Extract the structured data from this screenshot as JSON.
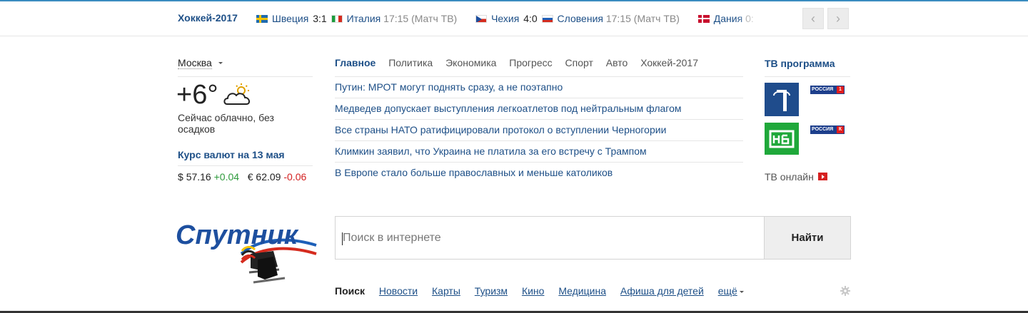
{
  "scorebar": {
    "title": "Хоккей-2017",
    "matches": [
      {
        "flag1": "se",
        "team1": "Швеция",
        "score": "3:1",
        "flag2": "it",
        "team2": "Италия",
        "time": "17:15 (Матч ТВ)"
      },
      {
        "flag1": "cz",
        "team1": "Чехия",
        "score": "4:0",
        "flag2": "si",
        "team2": "Словения",
        "time": "17:15 (Матч ТВ)"
      },
      {
        "flag1": "dk",
        "team1": "Дания",
        "score": "0:",
        "flag2": "",
        "team2": "",
        "time": ""
      }
    ],
    "prev_label": "‹",
    "next_label": "›"
  },
  "weather": {
    "city": "Москва",
    "temp": "+6°",
    "description": "Сейчас облачно, без осадков",
    "icon": "cloudy-sun-icon"
  },
  "rates": {
    "title": "Курс валют на 13 мая",
    "usd_symbol": "$",
    "usd_value": "57.16",
    "usd_change": "+0.04",
    "eur_symbol": "€",
    "eur_value": "62.09",
    "eur_change": "-0.06"
  },
  "news": {
    "tabs": [
      "Главное",
      "Политика",
      "Экономика",
      "Прогресс",
      "Спорт",
      "Авто",
      "Хоккей-2017"
    ],
    "items": [
      "Путин: МРОТ могут поднять сразу, а не поэтапно",
      "Медведев допускает выступления легкоатлетов под нейтральным флагом",
      "Все страны НАТО ратифицировали протокол о вступлении Черногории",
      "Климкин заявил, что Украина не платила за его встречу с Трампом",
      "В Европе стало больше православных и меньше католиков"
    ]
  },
  "tv": {
    "title": "ТВ программа",
    "channels": [
      "Первый канал",
      "НТВ",
      "Россия 1",
      "Россия К"
    ],
    "rus1_label": "РОССИЯ",
    "rus1_badge": "1",
    "rus2_label": "РОССИЯ",
    "rus2_badge": "К",
    "online": "ТВ онлайн"
  },
  "logo_text": "Спутник",
  "search": {
    "placeholder": "Поиск в интернете",
    "button": "Найти"
  },
  "services": {
    "items": [
      "Поиск",
      "Новости",
      "Карты",
      "Туризм",
      "Кино",
      "Медицина",
      "Афиша для детей",
      "ещё"
    ]
  },
  "colors": {
    "link": "#1d4f87",
    "up": "#2e9a3c",
    "down": "#d32020"
  }
}
